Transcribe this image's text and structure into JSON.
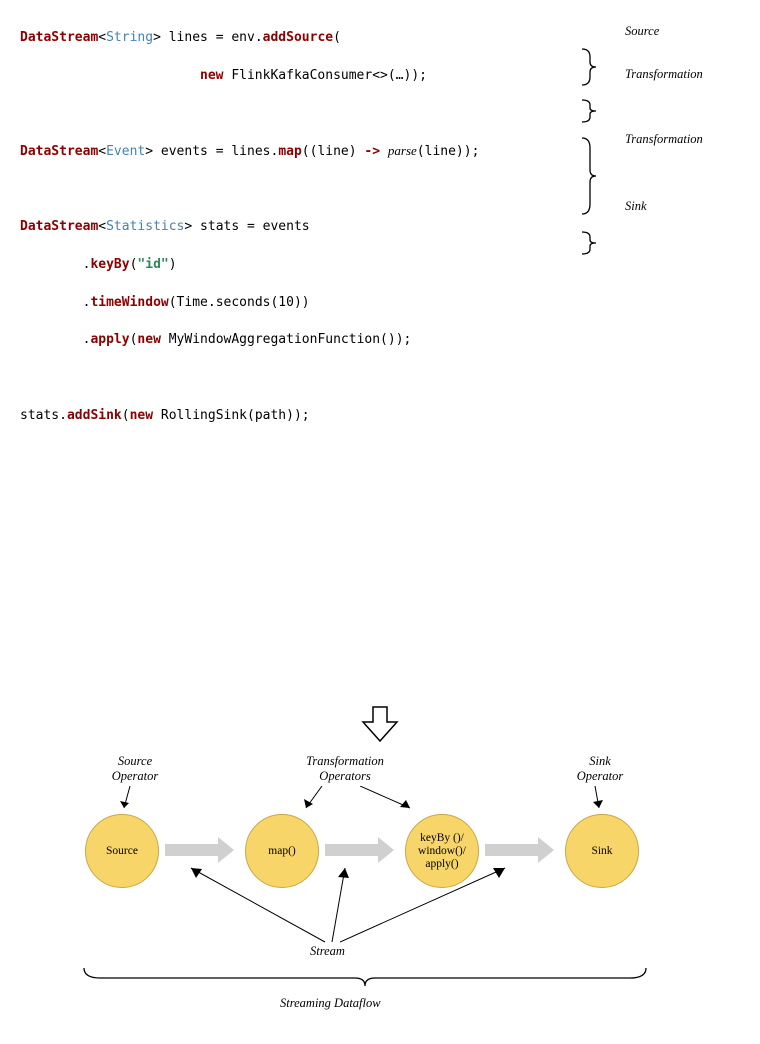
{
  "code": {
    "l1_1": "DataStream",
    "l1_2": "String",
    "l1_3": "> lines = env.",
    "l1_4": "addSource",
    "l1_5": "(",
    "l2_1": "new",
    "l2_2": " FlinkKafkaConsumer<>(…));",
    "l3_1": "DataStream",
    "l3_2": "Event",
    "l3_3": "> events = lines.",
    "l3_4": "map",
    "l3_5": "((line) ",
    "l3_6": "->",
    "l3_7": " ",
    "l3_8": "parse",
    "l3_9": "(line));",
    "l4_1": "DataStream",
    "l4_2": "Statistics",
    "l4_3": "> stats = events",
    "l5_1": "keyBy",
    "l5_2": "(",
    "l5_3": "\"id\"",
    "l5_4": ")",
    "l6_1": "timeWindow",
    "l6_2": "(Time.seconds(10))",
    "l7_1": "apply",
    "l7_2": "(",
    "l7_3": "new",
    "l7_4": " MyWindowAggregationFunction());",
    "l8_1": "stats.",
    "l8_2": "addSink",
    "l8_3": "(",
    "l8_4": "new",
    "l8_5": " RollingSink(path));"
  },
  "braces": {
    "b1": "Source",
    "b2": "Transformation",
    "b3": "Transformation",
    "b4": "Sink"
  },
  "diagram": {
    "nodes": {
      "n1": "Source",
      "n2": "map()",
      "n3": "keyBy ()/\nwindow()/\napply()",
      "n4": "Sink"
    },
    "labels": {
      "l_src": "Source\nOperator",
      "l_trans": "Transformation\nOperators",
      "l_sink": "Sink\nOperator",
      "l_stream": "Stream",
      "l_dataflow": "Streaming Dataflow"
    }
  }
}
